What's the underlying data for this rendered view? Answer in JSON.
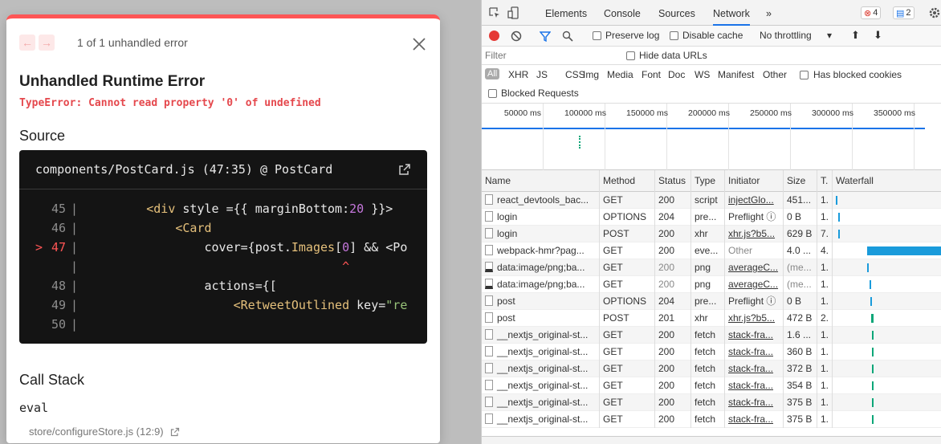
{
  "overlay": {
    "nav_prev": "←",
    "nav_next": "→",
    "count_text": "1 of 1 unhandled error",
    "title": "Unhandled Runtime Error",
    "message": "TypeError: Cannot read property '0' of undefined",
    "source_heading": "Source",
    "file_location": "components/PostCard.js (47:35) @ PostCard",
    "code_lines": [
      {
        "marker": "",
        "num": "45",
        "code_plain": "        ",
        "code_tag": "<div",
        "code_rest": " style ={{ marginBottom:",
        "code_num": "20",
        "code_tail": " }}>"
      },
      {
        "marker": "",
        "num": "46",
        "code_plain": "            ",
        "code_tag": "<Card",
        "code_rest": "",
        "code_num": "",
        "code_tail": ""
      },
      {
        "marker": ">",
        "num": "47",
        "code_plain": "                cover={post.",
        "code_tag": "Images",
        "code_rest": "[",
        "code_num": "0",
        "code_tail": "] && <Po"
      },
      {
        "marker": "",
        "num": "",
        "code_plain": "                                   ",
        "code_tag": "",
        "code_rest": "",
        "code_num": "",
        "code_tail": "^"
      },
      {
        "marker": "",
        "num": "48",
        "code_plain": "                actions={[",
        "code_tag": "",
        "code_rest": "",
        "code_num": "",
        "code_tail": ""
      },
      {
        "marker": "",
        "num": "49",
        "code_plain": "                    ",
        "code_tag": "<RetweetOutlined",
        "code_rest": " key=",
        "code_num": "",
        "code_tail": "\"re"
      },
      {
        "marker": "",
        "num": "50",
        "code_plain": "",
        "code_tag": "",
        "code_rest": "",
        "code_num": "",
        "code_tail": ""
      }
    ],
    "callstack_heading": "Call Stack",
    "frame_fn": "eval",
    "frame_file": "store/configureStore.js (12:9)"
  },
  "devtools": {
    "tabs": [
      "Elements",
      "Console",
      "Sources",
      "Network"
    ],
    "active_tab": "Network",
    "more": "»",
    "errors_count": "4",
    "messages_count": "2",
    "preserve_log": "Preserve log",
    "disable_cache": "Disable cache",
    "throttling": "No throttling",
    "filter_placeholder": "Filter",
    "hide_data_urls": "Hide data URLs",
    "type_filters": [
      "All",
      "XHR",
      "JS",
      "CSS",
      "Img",
      "Media",
      "Font",
      "Doc",
      "WS",
      "Manifest",
      "Other"
    ],
    "has_blocked_cookies": "Has blocked cookies",
    "blocked_requests": "Blocked Requests",
    "timeline_ticks": [
      "50000 ms",
      "100000 ms",
      "150000 ms",
      "200000 ms",
      "250000 ms",
      "300000 ms",
      "350000 ms",
      "400"
    ],
    "columns": [
      "Name",
      "Method",
      "Status",
      "Type",
      "Initiator",
      "Size",
      "T.",
      "Waterfall"
    ],
    "requests": [
      {
        "name": "react_devtools_bac...",
        "method": "GET",
        "status": "200",
        "type": "script",
        "initiator": "injectGlo...",
        "size": "451...",
        "time": "1.",
        "icon": "file",
        "status_dim": false,
        "initiator_style": "link",
        "size_dim": false
      },
      {
        "name": "login",
        "method": "OPTIONS",
        "status": "204",
        "type": "pre...",
        "initiator": "Preflight ⓘ",
        "size": "0 B",
        "time": "1.",
        "icon": "file",
        "status_dim": false,
        "initiator_style": "plain",
        "size_dim": false
      },
      {
        "name": "login",
        "method": "POST",
        "status": "200",
        "type": "xhr",
        "initiator": "xhr.js?b5...",
        "size": "629 B",
        "time": "7.",
        "icon": "file",
        "status_dim": false,
        "initiator_style": "link",
        "size_dim": false
      },
      {
        "name": "webpack-hmr?pag...",
        "method": "GET",
        "status": "200",
        "type": "eve...",
        "initiator": "Other",
        "size": "4.0 ...",
        "time": "4.",
        "icon": "file",
        "status_dim": false,
        "initiator_style": "dim",
        "size_dim": false
      },
      {
        "name": "data:image/png;ba...",
        "method": "GET",
        "status": "200",
        "type": "png",
        "initiator": "averageC...",
        "size": "(me...",
        "time": "1.",
        "icon": "img",
        "status_dim": true,
        "initiator_style": "link",
        "size_dim": true
      },
      {
        "name": "data:image/png;ba...",
        "method": "GET",
        "status": "200",
        "type": "png",
        "initiator": "averageC...",
        "size": "(me...",
        "time": "1.",
        "icon": "img",
        "status_dim": true,
        "initiator_style": "link",
        "size_dim": true
      },
      {
        "name": "post",
        "method": "OPTIONS",
        "status": "204",
        "type": "pre...",
        "initiator": "Preflight ⓘ",
        "size": "0 B",
        "time": "1.",
        "icon": "file",
        "status_dim": false,
        "initiator_style": "plain",
        "size_dim": false
      },
      {
        "name": "post",
        "method": "POST",
        "status": "201",
        "type": "xhr",
        "initiator": "xhr.js?b5...",
        "size": "472 B",
        "time": "2.",
        "icon": "file",
        "status_dim": false,
        "initiator_style": "link",
        "size_dim": false
      },
      {
        "name": "__nextjs_original-st...",
        "method": "GET",
        "status": "200",
        "type": "fetch",
        "initiator": "stack-fra...",
        "size": "1.6 ...",
        "time": "1.",
        "icon": "file",
        "status_dim": false,
        "initiator_style": "link",
        "size_dim": false
      },
      {
        "name": "__nextjs_original-st...",
        "method": "GET",
        "status": "200",
        "type": "fetch",
        "initiator": "stack-fra...",
        "size": "360 B",
        "time": "1.",
        "icon": "file",
        "status_dim": false,
        "initiator_style": "link",
        "size_dim": false
      },
      {
        "name": "__nextjs_original-st...",
        "method": "GET",
        "status": "200",
        "type": "fetch",
        "initiator": "stack-fra...",
        "size": "372 B",
        "time": "1.",
        "icon": "file",
        "status_dim": false,
        "initiator_style": "link",
        "size_dim": false
      },
      {
        "name": "__nextjs_original-st...",
        "method": "GET",
        "status": "200",
        "type": "fetch",
        "initiator": "stack-fra...",
        "size": "354 B",
        "time": "1.",
        "icon": "file",
        "status_dim": false,
        "initiator_style": "link",
        "size_dim": false
      },
      {
        "name": "__nextjs_original-st...",
        "method": "GET",
        "status": "200",
        "type": "fetch",
        "initiator": "stack-fra...",
        "size": "375 B",
        "time": "1.",
        "icon": "file",
        "status_dim": false,
        "initiator_style": "link",
        "size_dim": false
      },
      {
        "name": "__nextjs_original-st...",
        "method": "GET",
        "status": "200",
        "type": "fetch",
        "initiator": "stack-fra...",
        "size": "375 B",
        "time": "1.",
        "icon": "file",
        "status_dim": false,
        "initiator_style": "link",
        "size_dim": false
      }
    ],
    "colors": {
      "accent": "#1a73e8",
      "record": "#e53935",
      "error_red": "#ff5555"
    }
  }
}
